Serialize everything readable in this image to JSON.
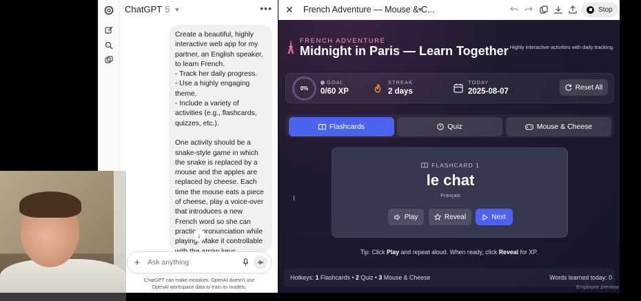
{
  "chat": {
    "title": "ChatGPT",
    "version": "5",
    "message": "Create a beautiful, highly interactive web app for my partner, an English speaker, to learn French.\n- Track her daily progress.\n- Use a highly engaging theme.\n- Include a variety of activities (e.g., flashcards, quizzes, etc.).\n\nOne activity should be a snake-style game in which the snake is replaced by a mouse and the apples are replaced by cheese. Each time the mouse eats a piece of cheese, play a voice-over that introduces a new French word so she can practice pronunciation while playing. Make it controllable with the arrow keys.",
    "composer_placeholder": "Ask anything",
    "disclaimer": "ChatGPT can make mistakes. OpenAI doesn't use OpenAI workspace data to train its models."
  },
  "canvas": {
    "title": "French Adventure — Mouse & C...",
    "stop_label": "Stop",
    "app": {
      "kicker": "FRENCH ADVENTURE",
      "title": "Midnight in Paris — Learn Together",
      "tagline": "Highly interactive activities with daily tracking.",
      "progress_label": "0%",
      "progress_value": 0,
      "goal": {
        "label": "GOAL",
        "value": "0/60 XP"
      },
      "streak": {
        "label": "STREAK",
        "value": "2 days"
      },
      "today": {
        "label": "TODAY",
        "value": "2025-08-07"
      },
      "reset_label": "Reset All",
      "tabs": [
        {
          "label": "Flashcards",
          "icon": "book-icon"
        },
        {
          "label": "Quiz",
          "icon": "quiz-icon"
        },
        {
          "label": "Mouse & Cheese",
          "icon": "gamepad-icon"
        }
      ],
      "flashcard": {
        "label": "FLASHCARD 1",
        "word": "le chat",
        "language": "Français",
        "play_label": "Play",
        "reveal_label": "Reveal",
        "next_label": "Next"
      },
      "tip": {
        "pre": "Tip: Click ",
        "play": "Play",
        "mid": " and repeat aloud. When ready, click ",
        "reveal": "Reveal",
        "post": " for XP."
      },
      "hotkeys": {
        "prefix": "Hotkeys: ",
        "k1": "1",
        "l1": " Flashcards • ",
        "k2": "2",
        "l2": " Quiz • ",
        "k3": "3",
        "l3": " Mouse & Cheese"
      },
      "words_learned": "Words learned today: 0"
    },
    "employee_preview": "Employee preview"
  },
  "colors": {
    "accent": "#4c63f0",
    "background": "#17172a",
    "kicker": "#e6a7b6"
  }
}
